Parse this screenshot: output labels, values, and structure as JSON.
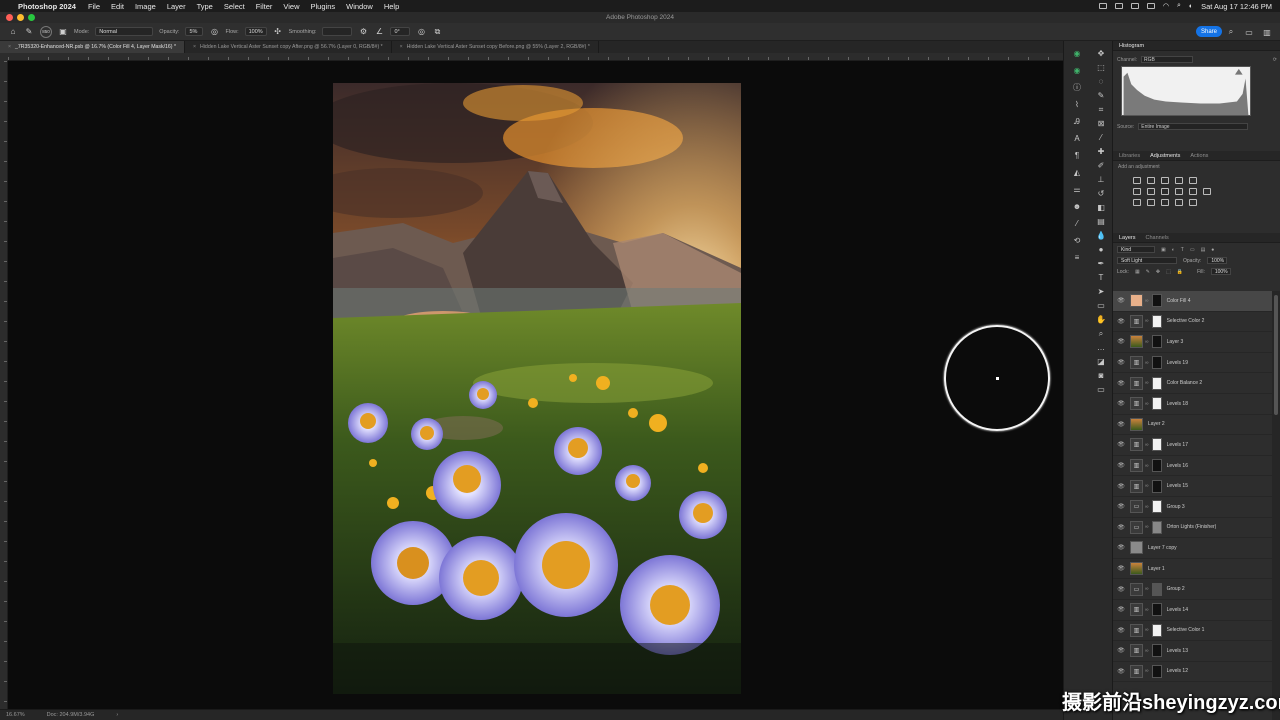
{
  "menubar": {
    "app": "Photoshop 2024",
    "items": [
      "File",
      "Edit",
      "Image",
      "Layer",
      "Type",
      "Select",
      "Filter",
      "View",
      "Plugins",
      "Window",
      "Help"
    ],
    "clock": "Sat Aug 17  12:46 PM"
  },
  "window": {
    "title": "Adobe Photoshop 2024"
  },
  "options": {
    "mode_label": "Mode:",
    "mode_value": "Normal",
    "opacity_label": "Opacity:",
    "opacity_value": "5%",
    "flow_label": "Flow:",
    "flow_value": "100%",
    "smoothing_label": "Smoothing:",
    "angle_value": "0°",
    "brush_size": "850",
    "share_label": "Share"
  },
  "tabs": [
    {
      "label": "_7R35320-Enhanced-NR.psb @ 16.7% (Color Fill 4, Layer Mask/16) *",
      "active": true
    },
    {
      "label": "Hidden Lake Vertical Aster Sunset copy After.png @ 56.7% (Layer 0, RGB/8#) *",
      "active": false
    },
    {
      "label": "Hidden Lake Vertical Aster Sunset copy Before.png @ 55% (Layer 2, RGB/8#) *",
      "active": false
    }
  ],
  "status": {
    "zoom": "16.67%",
    "doc": "Doc: 204.9M/3.94G"
  },
  "histogram": {
    "tab": "Histogram",
    "channel_label": "Channel:",
    "channel_value": "RGB",
    "source_label": "Source:",
    "source_value": "Entire Image"
  },
  "adjustments": {
    "tabs": [
      "Libraries",
      "Adjustments",
      "Actions"
    ],
    "active_tab": "Adjustments",
    "add_label": "Add an adjustment"
  },
  "layers_panel": {
    "tabs": [
      "Layers",
      "Channels"
    ],
    "kind_label": "Kind",
    "blend_mode": "Soft Light",
    "opacity_label": "Opacity:",
    "opacity_value": "100%",
    "lock_label": "Lock:",
    "fill_label": "Fill:",
    "fill_value": "100%",
    "layers": [
      {
        "name": "Color Fill 4",
        "thumb": "#e8b08a",
        "mask": "#111111",
        "selected": true
      },
      {
        "name": "Selective Color 2",
        "thumb": "adj",
        "mask": "#f2f2f2"
      },
      {
        "name": "Layer 3",
        "thumb": "photo",
        "mask": "#111111"
      },
      {
        "name": "Levels 19",
        "thumb": "adj",
        "mask": "#111111"
      },
      {
        "name": "Color Balance 2",
        "thumb": "adj",
        "mask": "#f2f2f2"
      },
      {
        "name": "Levels 18",
        "thumb": "adj",
        "mask": "#f2f2f2"
      },
      {
        "name": "Layer 2",
        "thumb": "photo",
        "mask": ""
      },
      {
        "name": "Levels 17",
        "thumb": "adj",
        "mask": "#f2f2f2"
      },
      {
        "name": "Levels 16",
        "thumb": "adj",
        "mask": "#111111"
      },
      {
        "name": "Levels 15",
        "thumb": "adj",
        "mask": "#111111"
      },
      {
        "name": "Group 3",
        "thumb": "folder",
        "mask": "#f2f2f2"
      },
      {
        "name": "Orton Lights (Finisher)",
        "thumb": "folder",
        "mask": "#888888"
      },
      {
        "name": "Layer 7 copy",
        "thumb": "#8a8a8a",
        "mask": ""
      },
      {
        "name": "Layer 1",
        "thumb": "photo",
        "mask": ""
      },
      {
        "name": "Group 2",
        "thumb": "folder",
        "mask": "#555555"
      },
      {
        "name": "Levels 14",
        "thumb": "adj",
        "mask": "#111111"
      },
      {
        "name": "Selective Color 1",
        "thumb": "adj",
        "mask": "#f2f2f2"
      },
      {
        "name": "Levels 13",
        "thumb": "adj",
        "mask": "#111111"
      },
      {
        "name": "Levels 12",
        "thumb": "adj",
        "mask": "#111111"
      }
    ]
  },
  "watermark": "摄影前沿sheyingzyz.com"
}
